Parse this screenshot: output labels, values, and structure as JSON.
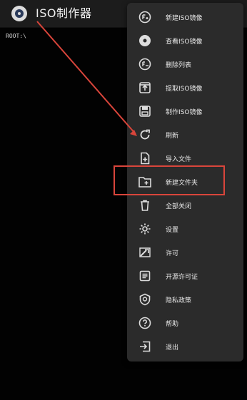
{
  "app": {
    "title": "ISO制作器",
    "icon": "disc-icon"
  },
  "browser": {
    "path": "ROOT:\\"
  },
  "menu": {
    "items": [
      {
        "label": "新建ISO镜像",
        "icon": "new-iso-icon"
      },
      {
        "label": "查看ISO镜像",
        "icon": "view-iso-icon"
      },
      {
        "label": "删除列表",
        "icon": "delete-list-icon"
      },
      {
        "label": "提取ISO镜像",
        "icon": "extract-iso-icon"
      },
      {
        "label": "制作ISO镜像",
        "icon": "make-iso-icon"
      },
      {
        "label": "刷新",
        "icon": "refresh-icon"
      },
      {
        "label": "导入文件",
        "icon": "import-file-icon"
      },
      {
        "label": "新建文件夹",
        "icon": "new-folder-icon"
      },
      {
        "label": "全部关闭",
        "icon": "trash-icon"
      },
      {
        "label": "设置",
        "icon": "gear-icon"
      },
      {
        "label": "许可",
        "icon": "license-icon"
      },
      {
        "label": "开源许可证",
        "icon": "open-source-license-icon"
      },
      {
        "label": "隐私政策",
        "icon": "privacy-icon"
      },
      {
        "label": "帮助",
        "icon": "help-icon"
      },
      {
        "label": "退出",
        "icon": "exit-icon"
      }
    ]
  },
  "colors": {
    "annotation": "#d9453b",
    "menu_bg": "#2b2b2b",
    "appbar_bg": "#1c1c1c"
  }
}
